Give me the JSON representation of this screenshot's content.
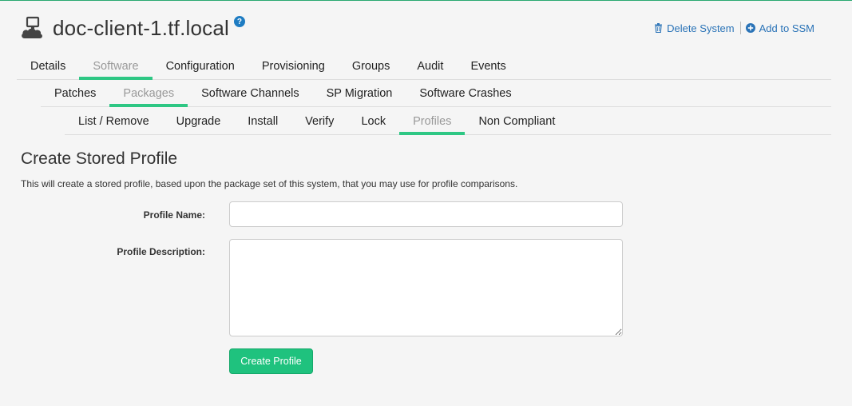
{
  "header": {
    "title": "doc-client-1.tf.local",
    "system_icon": "cloud-computer-icon",
    "help_icon": "question-circle-icon",
    "help_glyph": "?"
  },
  "actions": {
    "delete_system": "Delete System",
    "add_to_ssm": "Add to SSM"
  },
  "tabs_level1": [
    {
      "label": "Details",
      "active": false
    },
    {
      "label": "Software",
      "active": true
    },
    {
      "label": "Configuration",
      "active": false
    },
    {
      "label": "Provisioning",
      "active": false
    },
    {
      "label": "Groups",
      "active": false
    },
    {
      "label": "Audit",
      "active": false
    },
    {
      "label": "Events",
      "active": false
    }
  ],
  "tabs_level2": [
    {
      "label": "Patches",
      "active": false
    },
    {
      "label": "Packages",
      "active": true
    },
    {
      "label": "Software Channels",
      "active": false
    },
    {
      "label": "SP Migration",
      "active": false
    },
    {
      "label": "Software Crashes",
      "active": false
    }
  ],
  "tabs_level3": [
    {
      "label": "List / Remove",
      "active": false
    },
    {
      "label": "Upgrade",
      "active": false
    },
    {
      "label": "Install",
      "active": false
    },
    {
      "label": "Verify",
      "active": false
    },
    {
      "label": "Lock",
      "active": false
    },
    {
      "label": "Profiles",
      "active": true
    },
    {
      "label": "Non Compliant",
      "active": false
    }
  ],
  "section": {
    "title": "Create Stored Profile",
    "description": "This will create a stored profile, based upon the package set of this system, that you may use for profile comparisons."
  },
  "form": {
    "profile_name_label": "Profile Name:",
    "profile_name_value": "",
    "profile_description_label": "Profile Description:",
    "profile_description_value": "",
    "submit_label": "Create Profile"
  },
  "colors": {
    "accent": "#2ec784",
    "button": "#1fc27e",
    "link": "#2a73b7"
  }
}
